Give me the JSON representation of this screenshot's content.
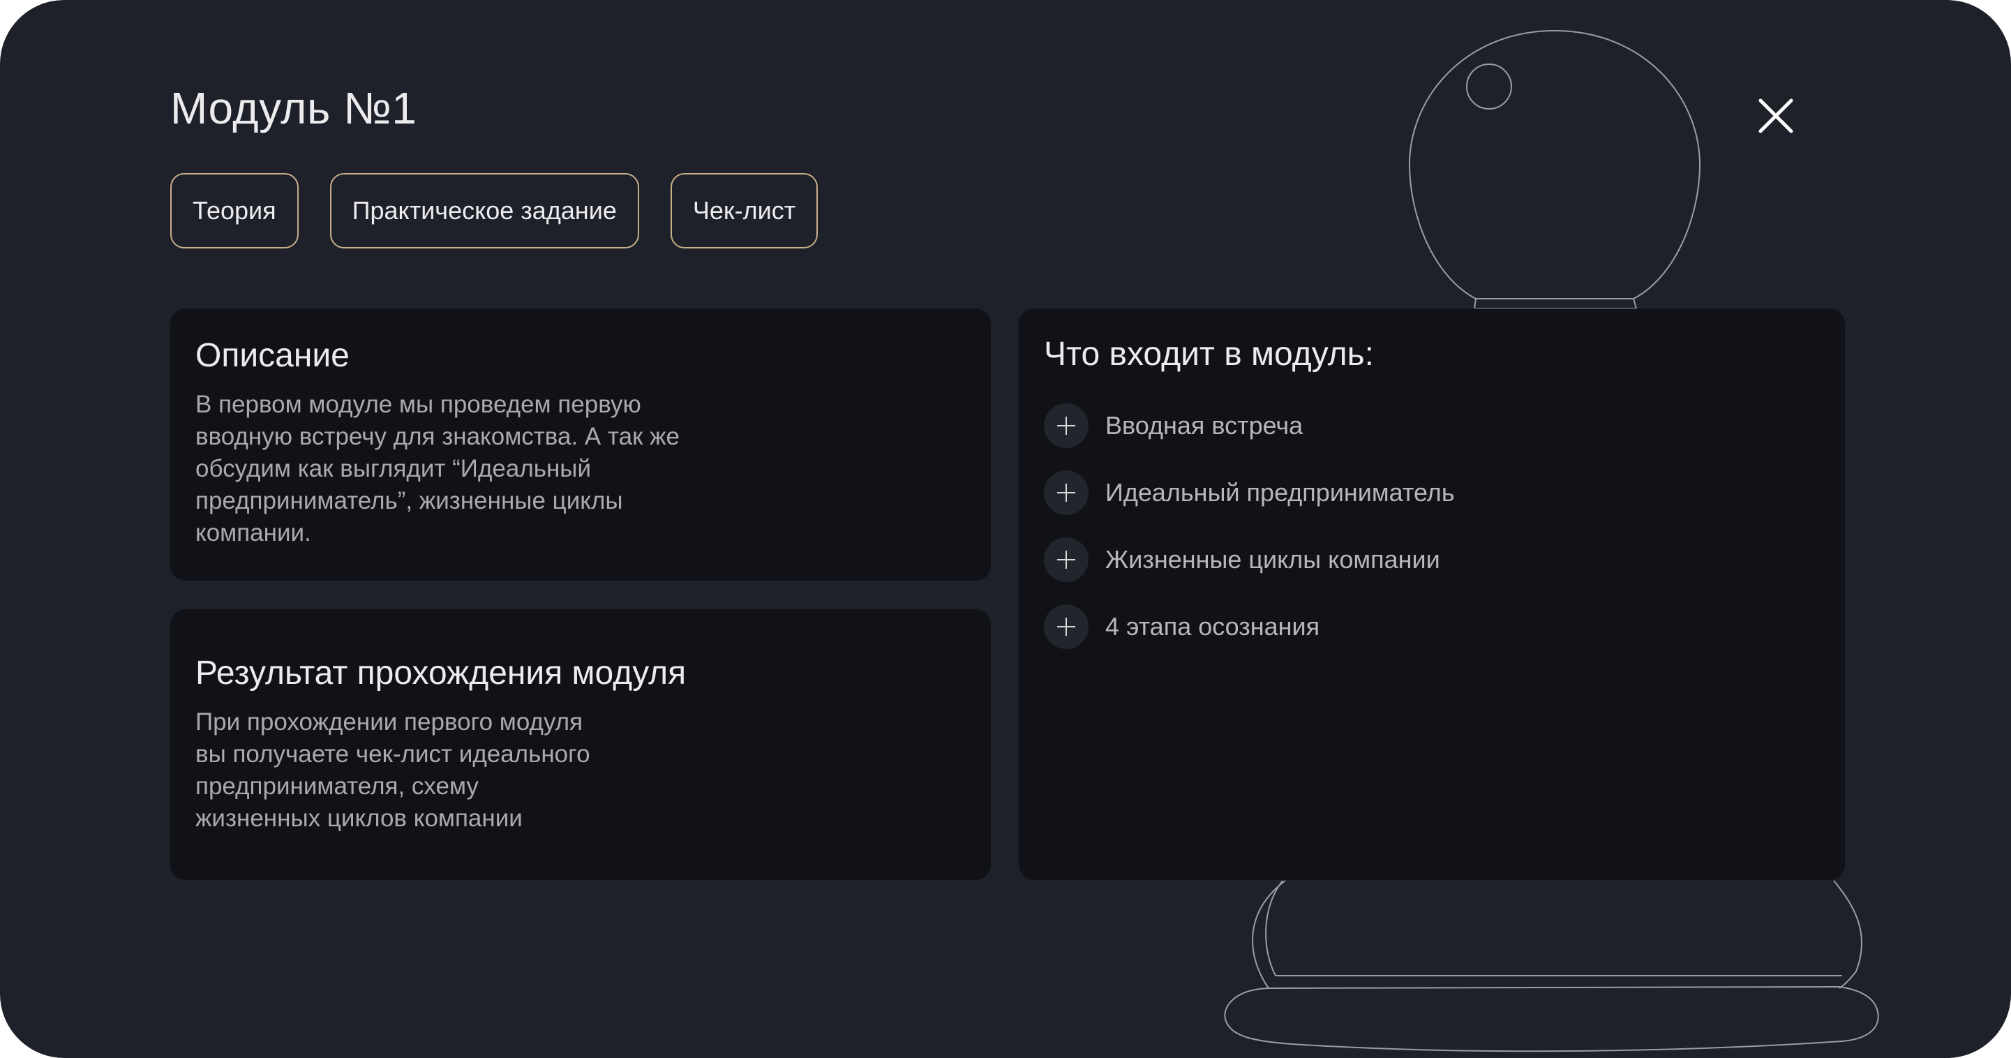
{
  "modal": {
    "title": "Модуль №1",
    "close_icon": "close-icon",
    "tabs": [
      {
        "label": "Теория"
      },
      {
        "label": "Практическое задание"
      },
      {
        "label": "Чек-лист"
      }
    ],
    "description": {
      "heading": "Описание",
      "text": "В первом модуле мы проведем первую\nвводную встречу для знакомства. А так же\nобсудим как выглядит “Идеальный\nпредприниматель”, жизненные циклы\nкомпании."
    },
    "result": {
      "heading": "Результат прохождения модуля",
      "text": "При прохождении первого модуля\nвы получаете чек-лист идеального\nпредпринимателя, схему\nжизненных циклов компании"
    },
    "contents": {
      "heading": "Что входит в модуль:",
      "item_icon": "plus-icon",
      "items": [
        {
          "label": "Вводная встреча"
        },
        {
          "label": "Идеальный предприниматель"
        },
        {
          "label": "Жизненные циклы компании"
        },
        {
          "label": "4 этапа осознания"
        }
      ]
    },
    "colors": {
      "background": "#1e202a",
      "card": "#111217",
      "tab_border": "#c9b08a",
      "text": "#ececee",
      "muted_text": "#a9aab1"
    }
  }
}
